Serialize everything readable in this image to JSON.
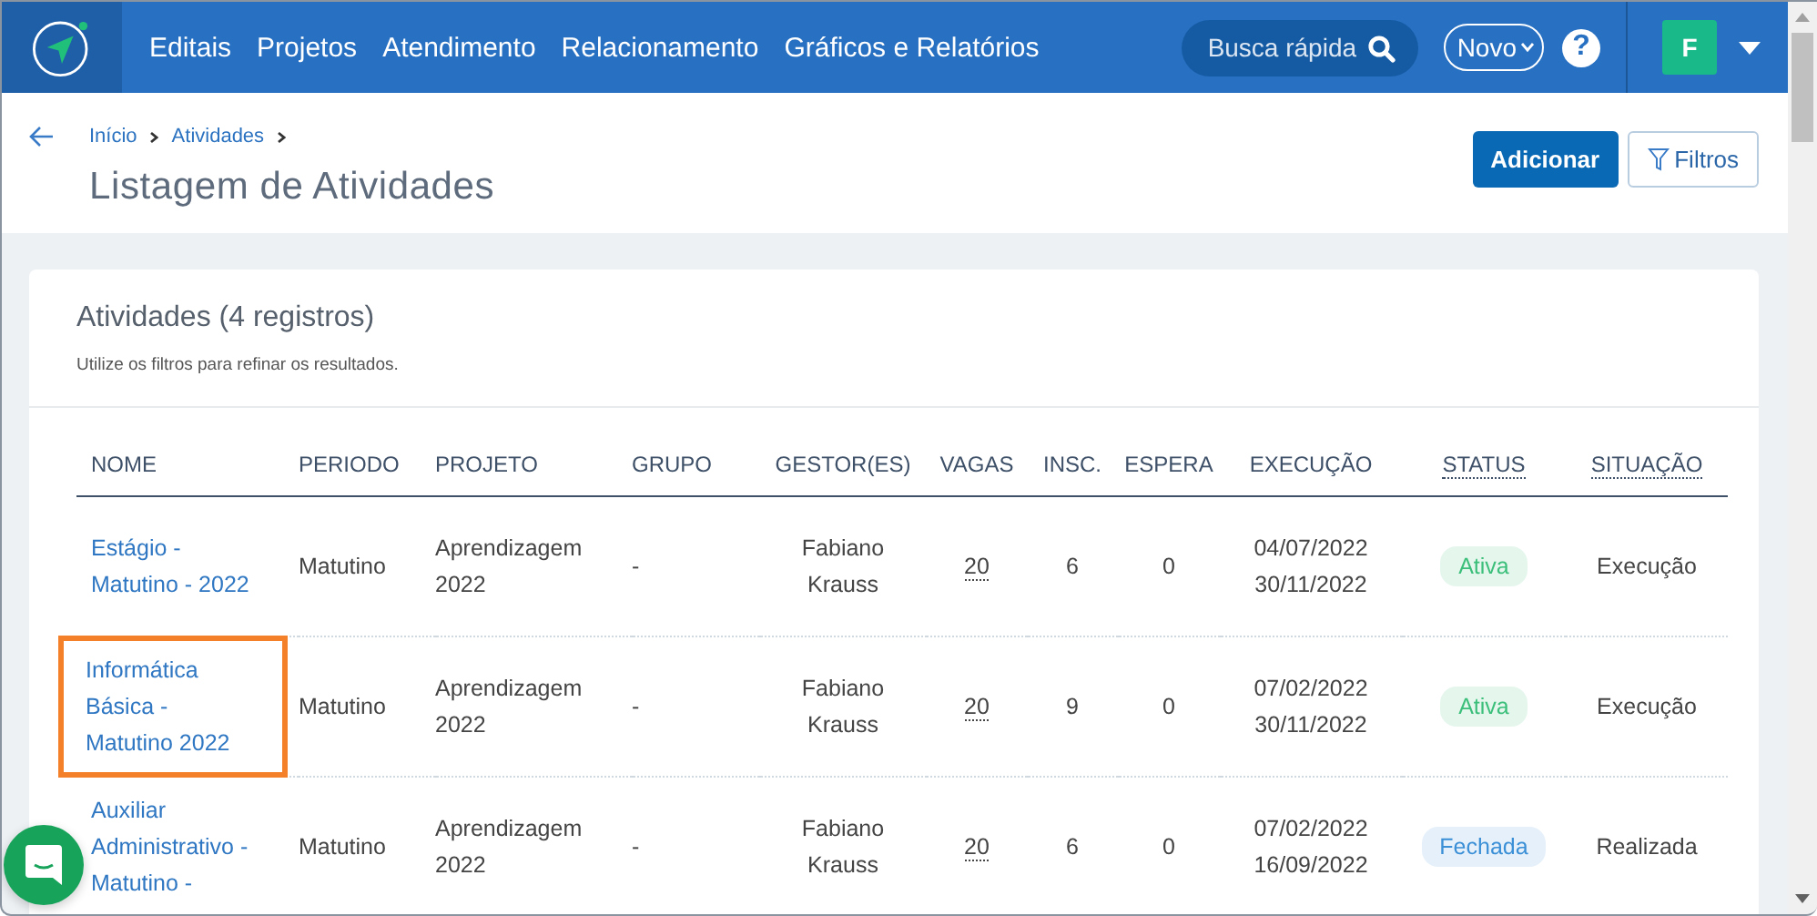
{
  "nav": {
    "items": [
      "Editais",
      "Projetos",
      "Atendimento",
      "Relacionamento",
      "Gráficos e Relatórios"
    ],
    "search": {
      "placeholder": "Busca rápida"
    },
    "new_button": "Novo",
    "help": "?",
    "avatar": "F"
  },
  "breadcrumb": [
    "Início",
    "Atividades"
  ],
  "page_title": "Listagem de Atividades",
  "actions": {
    "add": "Adicionar",
    "filters": "Filtros"
  },
  "card": {
    "title": "Atividades (4 registros)",
    "subtitle": "Utilize os filtros para refinar os resultados."
  },
  "table": {
    "columns": [
      {
        "label": "NOME",
        "hint": false
      },
      {
        "label": "PERIODO",
        "hint": false
      },
      {
        "label": "PROJETO",
        "hint": false
      },
      {
        "label": "GRUPO",
        "hint": false
      },
      {
        "label": "GESTOR(ES)",
        "hint": false
      },
      {
        "label": "VAGAS",
        "hint": false
      },
      {
        "label": "INSC.",
        "hint": false
      },
      {
        "label": "ESPERA",
        "hint": false
      },
      {
        "label": "EXECUÇÃO",
        "hint": false
      },
      {
        "label": "STATUS",
        "hint": true
      },
      {
        "label": "SITUAÇÃO",
        "hint": true
      }
    ],
    "rows": [
      {
        "nome": "Estágio - Matutino - 2022",
        "highlighted": false,
        "periodo": "Matutino",
        "projeto": "Aprendizagem 2022",
        "grupo": "-",
        "gestor": "Fabiano Krauss",
        "vagas": "20",
        "insc": "6",
        "espera": "0",
        "inicio": "04/07/2022",
        "fim": "30/11/2022",
        "status": {
          "label": "Ativa",
          "color": "#3cbf7a"
        },
        "situacao": "Execução"
      },
      {
        "nome": "Informática Básica - Matutino 2022",
        "highlighted": true,
        "periodo": "Matutino",
        "projeto": "Aprendizagem 2022",
        "grupo": "-",
        "gestor": "Fabiano Krauss",
        "vagas": "20",
        "insc": "9",
        "espera": "0",
        "inicio": "07/02/2022",
        "fim": "30/11/2022",
        "status": {
          "label": "Ativa",
          "color": "#3cbf7a"
        },
        "situacao": "Execução"
      },
      {
        "nome": "Auxiliar Administrativo - Matutino -",
        "highlighted": false,
        "periodo": "Matutino",
        "projeto": "Aprendizagem 2022",
        "grupo": "-",
        "gestor": "Fabiano Krauss",
        "vagas": "20",
        "insc": "6",
        "espera": "0",
        "inicio": "07/02/2022",
        "fim": "16/09/2022",
        "status": {
          "label": "Fechada",
          "color": "#3a8fd6"
        },
        "situacao": "Realizada"
      }
    ]
  }
}
